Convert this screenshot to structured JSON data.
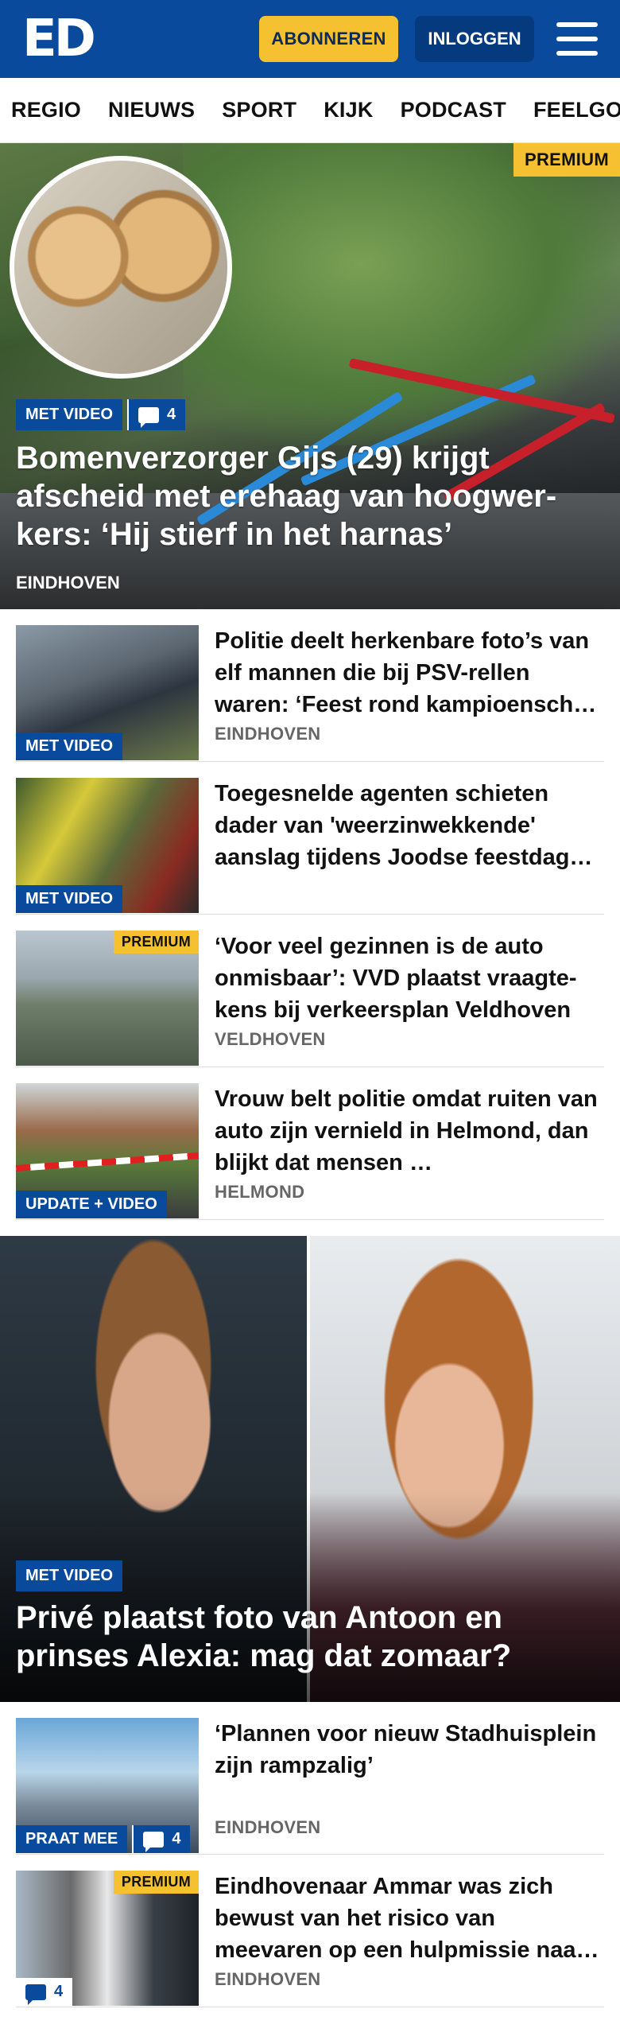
{
  "header": {
    "logo": "ED",
    "subscribe_label": "ABONNEREN",
    "login_label": "INLOGGEN",
    "menu_icon": "hamburger-menu-icon",
    "brand_color": "#0a4a9c",
    "accent_color": "#f5c130"
  },
  "nav": {
    "items": [
      {
        "label": "REGIO"
      },
      {
        "label": "NIEUWS"
      },
      {
        "label": "SPORT"
      },
      {
        "label": "KIJK"
      },
      {
        "label": "PODCAST"
      },
      {
        "label": "FEELGOOD"
      }
    ]
  },
  "hero": {
    "premium_label": "PREMIUM",
    "video_label": "MET VIDEO",
    "comment_count": "4",
    "title": "Bomenverzorger Gijs (29) krijgt afscheid met erehaag van hoogwer­kers: ‘Hij stierf in het harnas’",
    "region": "EINDHOVEN"
  },
  "articles": [
    {
      "tag": "MET VIDEO",
      "title": "Politie deelt herkenbare foto’s van elf mannen die bij PSV-rellen waren: ‘Feest rond kampioen­schap …",
      "region": "EINDHOVEN"
    },
    {
      "tag": "MET VIDEO",
      "title": "Toegesnelde agenten schieten dader van 'weerzinwekkende' aanslag tijdens Joodse feestdag dood",
      "region": ""
    },
    {
      "premium": "PREMIUM",
      "title": "‘Voor veel gezinnen is de auto onmisbaar’: VVD plaatst vraagte­kens bij verkeersplan Veldhoven",
      "region": "VELDHOVEN"
    },
    {
      "tag": "UPDATE + VIDEO",
      "title": "Vrouw belt politie omdat ruiten van auto zijn vernield in Helmond, dan blijkt dat mensen …",
      "region": "HELMOND"
    }
  ],
  "feature": {
    "video_label": "MET VIDEO",
    "title": "Privé plaatst foto van Antoon en prinses Alexia: mag dat zomaar?"
  },
  "articles2": [
    {
      "tag": "PRAAT MEE",
      "comment_count": "4",
      "title": "‘Plannen voor nieuw Stadhuis­plein zijn rampzalig’",
      "region": "EINDHOVEN"
    },
    {
      "premium": "PREMIUM",
      "comment_count": "4",
      "title": "Eindhovenaar Ammar was zich bewust van het risico van meevaren op een hulpmissie naar Gaza",
      "region": "EINDHOVEN"
    }
  ]
}
